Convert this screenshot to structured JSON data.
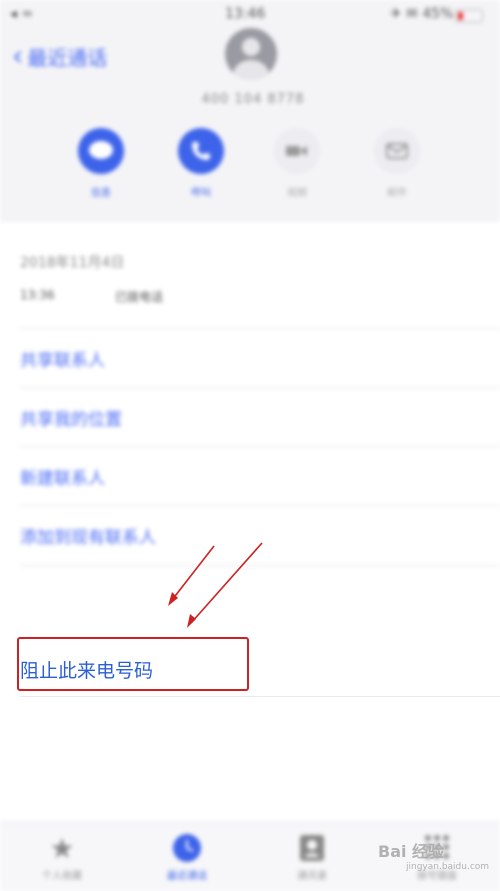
{
  "status_bar": {
    "left": "◂ ≈",
    "time": "13:46",
    "right": "✈ ✉ 45%"
  },
  "header": {
    "back_label": "最近通话",
    "number": "400 104 8778"
  },
  "actions": [
    {
      "label": "信息",
      "icon": "message-icon",
      "state": "active"
    },
    {
      "label": "呼叫",
      "icon": "phone-icon",
      "state": "active"
    },
    {
      "label": "视频",
      "icon": "video-icon",
      "state": "inactive"
    },
    {
      "label": "邮件",
      "icon": "mail-icon",
      "state": "inactive"
    }
  ],
  "call_info": {
    "date": "2018年11月4日",
    "time": "13:36",
    "type": "已拨电话"
  },
  "menu": [
    "共享联系人",
    "共享我的位置",
    "新建联系人",
    "添加到现有联系人"
  ],
  "block_caller_label": "阻止此来电号码",
  "tabbar": [
    {
      "label": "个人收藏",
      "icon": "star-icon"
    },
    {
      "label": "最近通话",
      "icon": "clock-icon",
      "active": true
    },
    {
      "label": "通讯录",
      "icon": "contacts-icon"
    },
    {
      "label": "拨号键盘",
      "icon": "keypad-icon"
    }
  ],
  "watermark": {
    "text": "Bai 经验",
    "sub": "jingyan.baidu.com"
  },
  "colors": {
    "accent": "#3d63ea",
    "highlight_box": "#cc2222",
    "arrow": "#cc2222"
  }
}
